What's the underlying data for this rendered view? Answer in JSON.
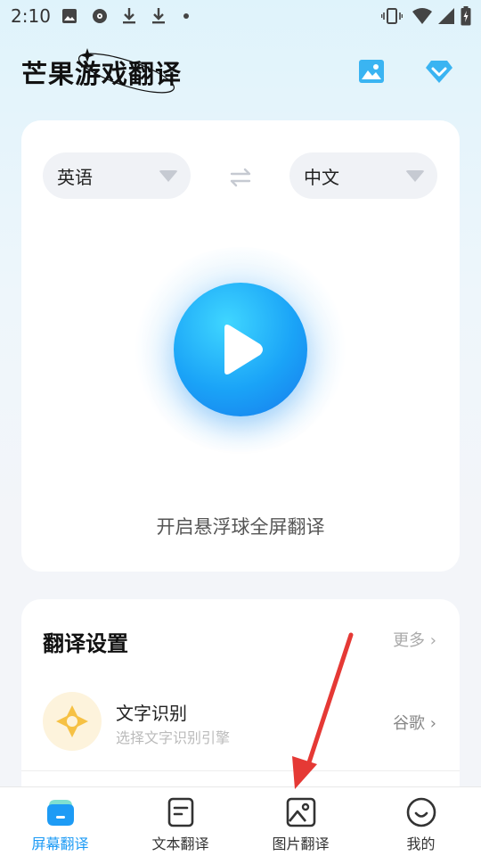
{
  "status_bar": {
    "time": "2:10"
  },
  "header": {
    "app_title": "芒果游戏翻译",
    "image_icon": "image-icon",
    "vip_icon": "diamond-icon"
  },
  "translator": {
    "source_lang": "英语",
    "target_lang": "中文",
    "swap_icon": "swap-arrows-icon",
    "play_icon": "play-icon",
    "caption": "开启悬浮球全屏翻译"
  },
  "settings": {
    "title": "翻译设置",
    "more": "更多",
    "ocr": {
      "title": "文字识别",
      "subtitle": "选择文字识别引擎",
      "value": "谷歌"
    }
  },
  "bottom_nav": {
    "items": [
      {
        "label": "屏幕翻译",
        "icon": "screen-translate-icon",
        "active": true
      },
      {
        "label": "文本翻译",
        "icon": "text-translate-icon",
        "active": false
      },
      {
        "label": "图片翻译",
        "icon": "image-translate-icon",
        "active": false
      },
      {
        "label": "我的",
        "icon": "profile-icon",
        "active": false
      }
    ]
  },
  "colors": {
    "accent": "#1d9bf5",
    "annotation_arrow": "#e53935"
  }
}
